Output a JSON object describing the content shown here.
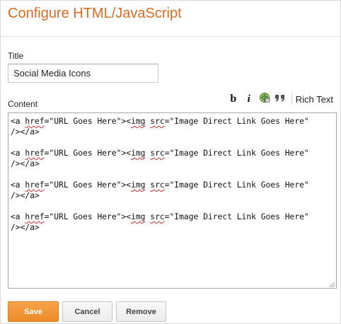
{
  "dialog": {
    "title": "Configure HTML/JavaScript"
  },
  "title_field": {
    "label": "Title",
    "value": "Social Media Icons"
  },
  "content_field": {
    "label": "Content",
    "toolbar": {
      "bold_label": "b",
      "italic_label": "i",
      "link_icon": "link-icon",
      "quote_icon": "quote-icon",
      "rich_text_label": "Rich Text"
    },
    "code_blocks": [
      {
        "line1": {
          "pre": "<a ",
          "attr1": "href",
          "mid": "=\"URL Goes Here\"><",
          "attr2": "img",
          "sp": " ",
          "attr3": "src",
          "post": "=\"Image Direct Link Goes Here\""
        },
        "line2": "/></a>"
      },
      {
        "line1": {
          "pre": "<a ",
          "attr1": "href",
          "mid": "=\"URL Goes Here\"><",
          "attr2": "img",
          "sp": " ",
          "attr3": "src",
          "post": "=\"Image Direct Link Goes Here\""
        },
        "line2": "/></a>"
      },
      {
        "line1": {
          "pre": "<a ",
          "attr1": "href",
          "mid": "=\"URL Goes Here\"><",
          "attr2": "img",
          "sp": " ",
          "attr3": "src",
          "post": "=\"Image Direct Link Goes Here\""
        },
        "line2": "/></a>"
      },
      {
        "line1": {
          "pre": "<a ",
          "attr1": "href",
          "mid": "=\"URL Goes Here\"><",
          "attr2": "img",
          "sp": " ",
          "attr3": "src",
          "post": "=\"Image Direct Link Goes Here\""
        },
        "line2": "/></a>"
      }
    ]
  },
  "buttons": {
    "save": "Save",
    "cancel": "Cancel",
    "remove": "Remove"
  },
  "colors": {
    "title_orange": "#dd6a20",
    "primary_button": "#ec8b28",
    "spellcheck_underline": "#d32f2f"
  }
}
